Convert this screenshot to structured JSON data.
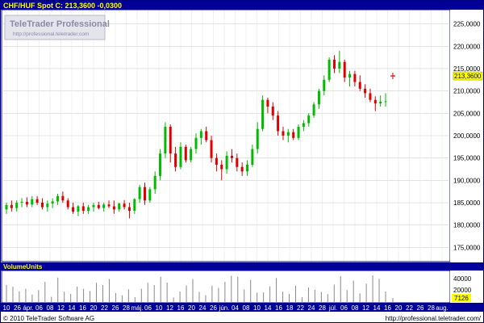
{
  "header": {
    "title": "CHF/HUF Spot C: 213,3600 -0,0300"
  },
  "watermark": {
    "brand": "TeleTrader Professional",
    "url": "http://professional.teletrader.com"
  },
  "volume_panel": {
    "title": "VolumeUnits",
    "tick_labels": [
      "40000",
      "20000"
    ],
    "last_value_label": "7126",
    "last_value": 7126
  },
  "footer": {
    "copyright": "© 2010 TeleTrader Software AG",
    "url": "http://professional.teletrader.com/"
  },
  "colors": {
    "up": "#00bb00",
    "down": "#dd0000",
    "header_bg": "#000099",
    "header_text": "#ffff00",
    "frame": "#0000aa",
    "last_label_bg": "#ffff00",
    "volume_bar": "#888888",
    "grid": "#d0d0d0"
  },
  "chart_data": {
    "type": "candlestick",
    "title": "CHF/HUF Spot C: 213,3600 -0,0300",
    "last_price_label": "213,3600",
    "last_price": 213.36,
    "ylim": [
      172,
      228
    ],
    "y_ticks": [
      {
        "value": 175,
        "label": "175,0000"
      },
      {
        "value": 180,
        "label": "180,0000"
      },
      {
        "value": 185,
        "label": "185,0000"
      },
      {
        "value": 190,
        "label": "190,0000"
      },
      {
        "value": 195,
        "label": "195,0000"
      },
      {
        "value": 200,
        "label": "200,0000"
      },
      {
        "value": 205,
        "label": "205,0000"
      },
      {
        "value": 210,
        "label": "210,0000"
      },
      {
        "value": 215,
        "label": "215,0000"
      },
      {
        "value": 220,
        "label": "220,0000"
      },
      {
        "value": 225,
        "label": "225,0000"
      }
    ],
    "x_tick_labels": [
      "10",
      "26",
      "ápr.",
      "06",
      "08",
      "12",
      "14",
      "16",
      "20",
      "22",
      "26",
      "28",
      "máj.",
      "06",
      "10",
      "12",
      "16",
      "20",
      "24",
      "26",
      "jún.",
      "04",
      "08",
      "10",
      "14",
      "16",
      "18",
      "22",
      "24",
      "28",
      "júl.",
      "06",
      "08",
      "12",
      "14",
      "16",
      "20",
      "22",
      "26",
      "28",
      "aug."
    ],
    "grid": true,
    "up_values": [
      12,
      14,
      16,
      19,
      21,
      22,
      23,
      32,
      34,
      35,
      36,
      38,
      39,
      40,
      41,
      42,
      44,
      45,
      46,
      48,
      55,
      56,
      58,
      59,
      60,
      62,
      64,
      66,
      68,
      74,
      75,
      80,
      81,
      82,
      84,
      86,
      87,
      88,
      89,
      90,
      94,
      96,
      97,
      106,
      107,
      108,
      116,
      117,
      118,
      119,
      120,
      121,
      122,
      127,
      128,
      129,
      130,
      131,
      136,
      137
    ],
    "down_values": [
      4,
      10,
      12,
      12,
      12,
      23,
      23,
      23,
      27,
      27,
      28,
      31,
      32,
      33,
      33,
      34,
      35,
      35,
      36,
      37,
      39,
      39,
      40,
      41,
      41,
      41,
      44,
      45,
      46,
      48,
      50,
      50,
      52,
      53,
      54,
      55,
      58,
      60,
      62,
      64,
      65,
      66,
      66,
      68,
      69,
      69,
      70,
      72,
      73,
      74,
      75,
      77,
      77,
      78,
      80,
      82,
      84,
      84,
      84,
      86
    ],
    "candles": [
      {
        "o": 183.5,
        "h": 185.0,
        "l": 182.5,
        "c": 184.5
      },
      {
        "o": 184.5,
        "h": 185.5,
        "l": 183.0,
        "c": 183.8
      },
      {
        "o": 183.8,
        "h": 185.5,
        "l": 183.0,
        "c": 185.0
      },
      {
        "o": 185.0,
        "h": 186.0,
        "l": 184.0,
        "c": 185.2
      },
      {
        "o": 185.2,
        "h": 186.2,
        "l": 184.0,
        "c": 184.6
      },
      {
        "o": 184.6,
        "h": 186.5,
        "l": 184.0,
        "c": 185.8
      },
      {
        "o": 185.8,
        "h": 186.5,
        "l": 184.5,
        "c": 185.0
      },
      {
        "o": 185.0,
        "h": 186.0,
        "l": 183.5,
        "c": 184.0
      },
      {
        "o": 184.0,
        "h": 185.5,
        "l": 183.0,
        "c": 184.8
      },
      {
        "o": 184.8,
        "h": 186.0,
        "l": 183.8,
        "c": 185.3
      },
      {
        "o": 185.3,
        "h": 187.0,
        "l": 184.5,
        "c": 186.5
      },
      {
        "o": 186.5,
        "h": 187.5,
        "l": 185.0,
        "c": 185.5
      },
      {
        "o": 185.5,
        "h": 186.0,
        "l": 183.5,
        "c": 184.0
      },
      {
        "o": 184.0,
        "h": 185.0,
        "l": 182.5,
        "c": 183.0
      },
      {
        "o": 183.0,
        "h": 184.5,
        "l": 182.0,
        "c": 184.2
      },
      {
        "o": 184.2,
        "h": 185.0,
        "l": 182.5,
        "c": 183.2
      },
      {
        "o": 183.2,
        "h": 184.5,
        "l": 182.5,
        "c": 184.0
      },
      {
        "o": 184.0,
        "h": 185.0,
        "l": 183.0,
        "c": 184.5
      },
      {
        "o": 184.5,
        "h": 185.2,
        "l": 183.5,
        "c": 183.8
      },
      {
        "o": 183.8,
        "h": 185.0,
        "l": 183.0,
        "c": 184.6
      },
      {
        "o": 184.6,
        "h": 185.5,
        "l": 183.8,
        "c": 184.2
      },
      {
        "o": 184.2,
        "h": 185.5,
        "l": 182.5,
        "c": 183.5
      },
      {
        "o": 183.5,
        "h": 185.0,
        "l": 183.0,
        "c": 184.8
      },
      {
        "o": 184.8,
        "h": 185.6,
        "l": 183.5,
        "c": 184.0
      },
      {
        "o": 184.0,
        "h": 185.0,
        "l": 181.5,
        "c": 183.2
      },
      {
        "o": 183.2,
        "h": 186.0,
        "l": 182.5,
        "c": 185.8
      },
      {
        "o": 185.8,
        "h": 189.0,
        "l": 185.0,
        "c": 188.5
      },
      {
        "o": 188.5,
        "h": 189.5,
        "l": 184.5,
        "c": 185.5
      },
      {
        "o": 185.5,
        "h": 188.5,
        "l": 185.0,
        "c": 188.0
      },
      {
        "o": 188.0,
        "h": 192.0,
        "l": 187.0,
        "c": 191.0
      },
      {
        "o": 191.0,
        "h": 197.0,
        "l": 190.0,
        "c": 196.0
      },
      {
        "o": 196.0,
        "h": 203.0,
        "l": 195.0,
        "c": 202.0
      },
      {
        "o": 202.0,
        "h": 202.5,
        "l": 194.0,
        "c": 196.0
      },
      {
        "o": 196.0,
        "h": 197.5,
        "l": 192.0,
        "c": 193.0
      },
      {
        "o": 193.0,
        "h": 198.5,
        "l": 192.5,
        "c": 197.5
      },
      {
        "o": 197.5,
        "h": 198.0,
        "l": 194.0,
        "c": 194.5
      },
      {
        "o": 194.5,
        "h": 197.5,
        "l": 194.0,
        "c": 197.0
      },
      {
        "o": 197.0,
        "h": 200.5,
        "l": 196.0,
        "c": 199.5
      },
      {
        "o": 199.5,
        "h": 201.5,
        "l": 198.0,
        "c": 201.0
      },
      {
        "o": 201.0,
        "h": 202.0,
        "l": 198.5,
        "c": 199.0
      },
      {
        "o": 199.0,
        "h": 200.0,
        "l": 194.0,
        "c": 195.0
      },
      {
        "o": 195.0,
        "h": 196.0,
        "l": 192.0,
        "c": 193.5
      },
      {
        "o": 193.5,
        "h": 194.5,
        "l": 190.0,
        "c": 192.5
      },
      {
        "o": 192.5,
        "h": 196.5,
        "l": 191.5,
        "c": 195.5
      },
      {
        "o": 195.5,
        "h": 197.0,
        "l": 194.0,
        "c": 195.0
      },
      {
        "o": 195.0,
        "h": 196.0,
        "l": 192.0,
        "c": 193.0
      },
      {
        "o": 193.0,
        "h": 194.0,
        "l": 191.0,
        "c": 192.0
      },
      {
        "o": 192.0,
        "h": 194.5,
        "l": 191.0,
        "c": 193.5
      },
      {
        "o": 193.5,
        "h": 198.0,
        "l": 193.0,
        "c": 197.0
      },
      {
        "o": 197.0,
        "h": 203.0,
        "l": 196.0,
        "c": 201.5
      },
      {
        "o": 201.5,
        "h": 209.0,
        "l": 201.0,
        "c": 208.0
      },
      {
        "o": 208.0,
        "h": 208.5,
        "l": 205.0,
        "c": 206.5
      },
      {
        "o": 206.5,
        "h": 207.5,
        "l": 203.5,
        "c": 204.5
      },
      {
        "o": 204.5,
        "h": 205.5,
        "l": 200.0,
        "c": 201.0
      },
      {
        "o": 201.0,
        "h": 202.0,
        "l": 199.0,
        "c": 200.0
      },
      {
        "o": 200.0,
        "h": 201.5,
        "l": 198.5,
        "c": 200.8
      },
      {
        "o": 200.8,
        "h": 201.5,
        "l": 199.0,
        "c": 199.5
      },
      {
        "o": 199.5,
        "h": 202.5,
        "l": 199.0,
        "c": 202.0
      },
      {
        "o": 202.0,
        "h": 203.5,
        "l": 201.0,
        "c": 202.8
      },
      {
        "o": 202.8,
        "h": 205.0,
        "l": 202.0,
        "c": 204.5
      },
      {
        "o": 204.5,
        "h": 207.5,
        "l": 204.0,
        "c": 207.0
      },
      {
        "o": 207.0,
        "h": 210.5,
        "l": 206.0,
        "c": 210.0
      },
      {
        "o": 210.0,
        "h": 213.5,
        "l": 209.0,
        "c": 212.5
      },
      {
        "o": 212.5,
        "h": 217.5,
        "l": 212.0,
        "c": 217.0
      },
      {
        "o": 217.0,
        "h": 218.0,
        "l": 214.0,
        "c": 215.0
      },
      {
        "o": 215.0,
        "h": 219.0,
        "l": 214.0,
        "c": 216.5
      },
      {
        "o": 216.5,
        "h": 217.0,
        "l": 212.0,
        "c": 213.0
      },
      {
        "o": 213.0,
        "h": 214.5,
        "l": 211.0,
        "c": 213.8
      },
      {
        "o": 213.8,
        "h": 214.5,
        "l": 211.0,
        "c": 212.0
      },
      {
        "o": 212.0,
        "h": 213.5,
        "l": 210.0,
        "c": 210.5
      },
      {
        "o": 210.5,
        "h": 211.5,
        "l": 208.5,
        "c": 209.5
      },
      {
        "o": 209.5,
        "h": 210.5,
        "l": 207.5,
        "c": 208.0
      },
      {
        "o": 208.0,
        "h": 208.8,
        "l": 205.5,
        "c": 207.2
      },
      {
        "o": 207.2,
        "h": 209.0,
        "l": 206.5,
        "c": 207.6
      },
      {
        "o": 207.6,
        "h": 209.5,
        "l": 206.5,
        "c": 207.7
      }
    ]
  }
}
